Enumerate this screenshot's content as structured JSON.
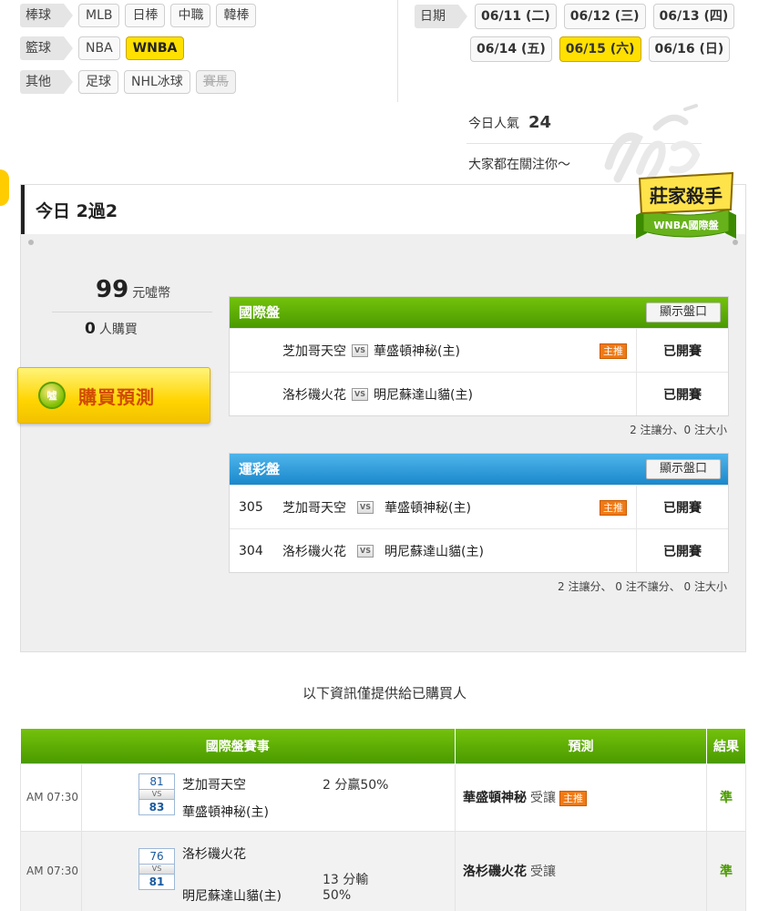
{
  "filters": {
    "baseball": {
      "label": "棒球",
      "items": [
        "MLB",
        "日棒",
        "中職",
        "韓棒"
      ]
    },
    "basketball": {
      "label": "籃球",
      "items": [
        "NBA",
        "WNBA"
      ],
      "active": "WNBA"
    },
    "other": {
      "label": "其他",
      "items": [
        "足球",
        "NHL冰球",
        "賽馬"
      ],
      "disabled": "賽馬"
    }
  },
  "dates": {
    "label": "日期",
    "row1": [
      "06/11 (二)",
      "06/12 (三)",
      "06/13 (四)"
    ],
    "row2": [
      "06/14 (五)",
      "06/15 (六)",
      "06/16 (日)"
    ],
    "active": "06/15 (六)"
  },
  "popularity": {
    "label": "今日人氣",
    "value": "24",
    "subtitle": "大家都在關注你～"
  },
  "panel": {
    "title": "今日 2過2",
    "badge_main": "莊家殺手",
    "badge_sub": "WNBA國際盤",
    "price_value": "99",
    "price_unit": "元噓幣",
    "buyers_value": "0",
    "buyers_unit": "人購買",
    "buy_button": "購買預測",
    "buy_coin": "噓"
  },
  "intl_box": {
    "title": "國際盤",
    "show_button": "顯示盤口",
    "rows": [
      {
        "home": "芝加哥天空",
        "away": "華盛頓神秘(主)",
        "tag": "主推",
        "status": "已開賽"
      },
      {
        "home": "洛杉磯火花",
        "away": "明尼蘇達山貓(主)",
        "tag": "",
        "status": "已開賽"
      }
    ],
    "footer": "2 注讓分、0 注大小"
  },
  "lottery_box": {
    "title": "運彩盤",
    "show_button": "顯示盤口",
    "rows": [
      {
        "num": "305",
        "home": "芝加哥天空",
        "away": "華盛頓神秘(主)",
        "tag": "主推",
        "status": "已開賽"
      },
      {
        "num": "304",
        "home": "洛杉磯火花",
        "away": "明尼蘇達山貓(主)",
        "tag": "",
        "status": "已開賽"
      }
    ],
    "footer": "2 注讓分、 0 注不讓分、 0 注大小"
  },
  "notice": "以下資訊僅提供給已購買人",
  "results": {
    "headers": {
      "game": "國際盤賽事",
      "prediction": "預測",
      "result": "結果"
    },
    "vs": "VS",
    "rows": [
      {
        "time": "AM 07:30",
        "score_top": "81",
        "score_bottom": "83",
        "team_top": "芝加哥天空",
        "team_bottom": "華盛頓神秘(主)",
        "line": "2 分贏50%",
        "pred_team": "華盛頓神秘",
        "pred_type": "受讓",
        "tag": "主推",
        "result": "準"
      },
      {
        "time": "AM 07:30",
        "score_top": "76",
        "score_bottom": "81",
        "team_top": "洛杉磯火花",
        "team_bottom": "明尼蘇達山貓(主)",
        "line": "13 分輸",
        "line2": "50%",
        "pred_team": "洛杉磯火花",
        "pred_type": "受讓",
        "tag": "",
        "result": "準"
      }
    ]
  },
  "colors": {
    "accent_yellow": "#ffe000",
    "green": "#4a9a00",
    "blue": "#1a88cc",
    "tag_orange": "#f07a14"
  }
}
